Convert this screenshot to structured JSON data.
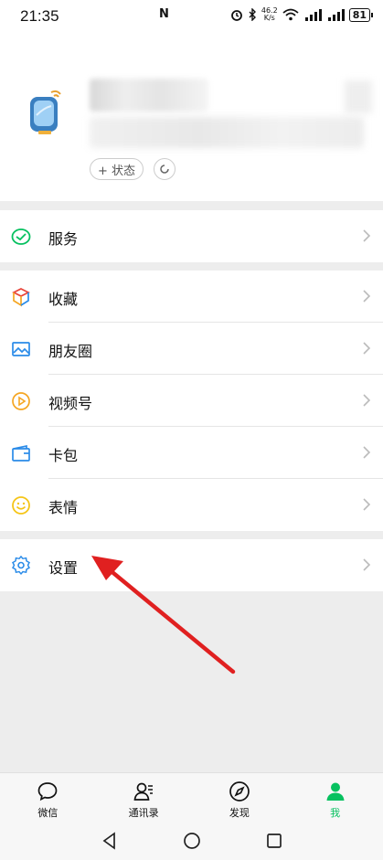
{
  "status_bar": {
    "time": "21:35",
    "nfc": "N",
    "speed_top": "46.2",
    "speed_bottom": "K/s",
    "battery": "81"
  },
  "profile": {
    "status_label": "+ 状态",
    "avatar_icon": "smartwatch-icon"
  },
  "menu": {
    "service": {
      "label": "服务",
      "icon": "wallet-check-icon"
    },
    "favorites": {
      "label": "收藏",
      "icon": "cube-icon"
    },
    "moments": {
      "label": "朋友圈",
      "icon": "image-icon"
    },
    "channels": {
      "label": "视频号",
      "icon": "play-circle-icon"
    },
    "cards": {
      "label": "卡包",
      "icon": "card-icon"
    },
    "stickers": {
      "label": "表情",
      "icon": "smile-icon"
    },
    "settings": {
      "label": "设置",
      "icon": "gear-icon"
    }
  },
  "tabbar": {
    "chats": "微信",
    "contacts": "通讯录",
    "discover": "发现",
    "me": "我"
  },
  "colors": {
    "accent": "#07c160",
    "annotation_arrow": "#e02020"
  }
}
